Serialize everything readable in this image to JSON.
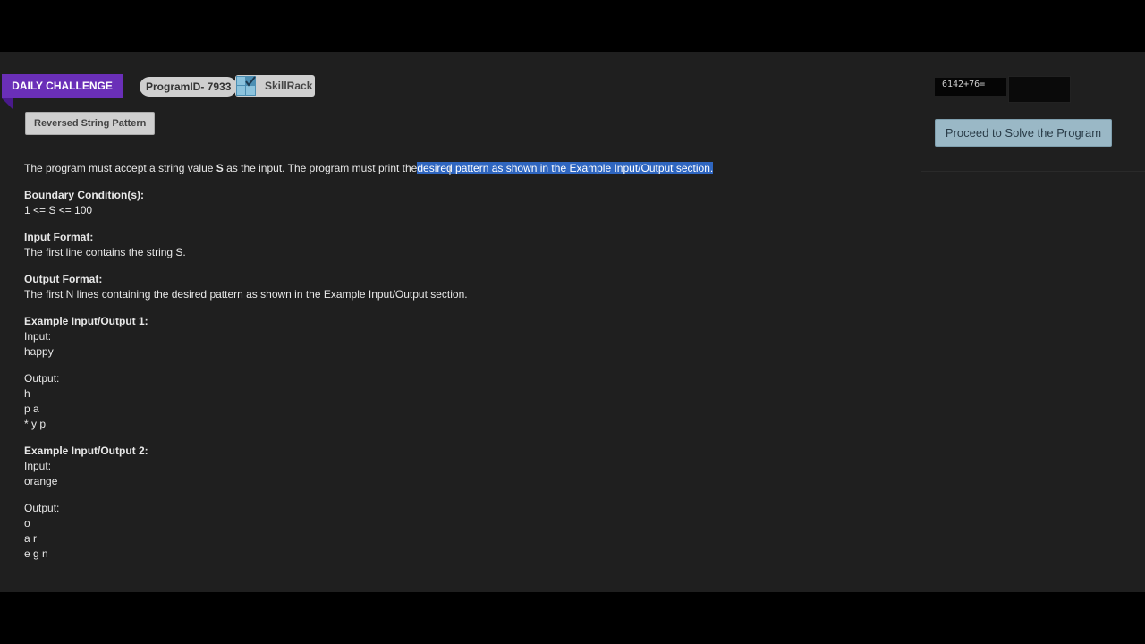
{
  "header": {
    "challenge_label": "DAILY CHALLENGE",
    "program_id": "ProgramID- 7933",
    "brand": "SkillRack",
    "problem_title": "Reversed String Pattern"
  },
  "captcha": {
    "question": "6142+76=",
    "answer": ""
  },
  "proceed_label": "Proceed to Solve the Program",
  "problem": {
    "intro_before": "The program must accept a string value ",
    "intro_var": "S",
    "intro_middle": " as the input. The program must print the",
    "intro_highlight": "desired pattern as shown in the Example Input/Output section.",
    "boundary_title": "Boundary Condition(s):",
    "boundary_text": "1 <= S <= 100",
    "input_title": "Input Format:",
    "input_text": "The first line contains the string S.",
    "output_title": "Output Format:",
    "output_text": "The first N lines containing the desired pattern as shown in the Example Input/Output section.",
    "example1": {
      "title": "Example Input/Output 1:",
      "input_label": "Input:",
      "input_value": "happy",
      "output_label": "Output:",
      "output_lines": [
        "h",
        "p a",
        "* y p"
      ]
    },
    "example2": {
      "title": "Example Input/Output 2:",
      "input_label": "Input:",
      "input_value": "orange",
      "output_label": "Output:",
      "output_lines": [
        "o",
        "a r",
        "e g n"
      ]
    }
  }
}
